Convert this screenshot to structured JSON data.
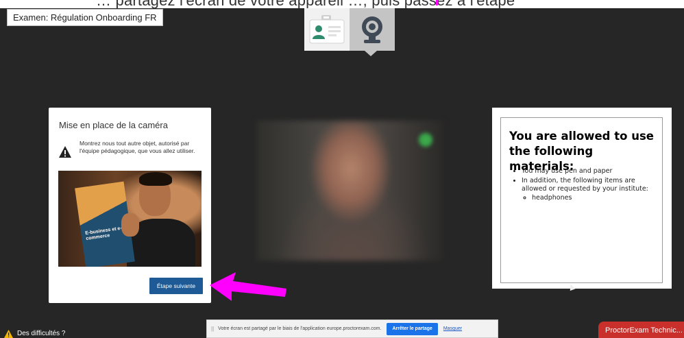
{
  "banner": {
    "text": "… partagez l'écran de votre appareil …, puis passez à l'étape"
  },
  "exam": {
    "title": "Examen: Régulation Onboarding FR"
  },
  "steps": [
    {
      "icon": "id-card-icon"
    },
    {
      "icon": "webcam-icon"
    }
  ],
  "camera_card": {
    "title": "Mise en place de la caméra",
    "instruction": "Montrez nous tout autre objet, autorisé par l'équipe pédagogique, que vous allez utiliser.",
    "book_text": "E-business et e-commerce",
    "next_label": "Étape suivante"
  },
  "materials": {
    "heading": "You are allowed to use the following materials:",
    "item1": "You may use pen and paper",
    "item2": "In addition, the following items are allowed or requested by your institute:",
    "subitem": "headphones"
  },
  "footer": {
    "difficulty": "Des difficultés ?",
    "share_text": "Votre écran est partagé par le biais de l'application europe.proctorexam.com.",
    "stop_label": "Arrêter le partage",
    "hide_label": "Masquer",
    "proctor_tab": "ProctorExam Technic..."
  },
  "colors": {
    "accent_blue": "#1e5a96",
    "share_blue": "#1a73e8",
    "proctor_red": "#c9302c",
    "arrow_pink": "#ff00ff",
    "status_green": "#3ba84a"
  }
}
